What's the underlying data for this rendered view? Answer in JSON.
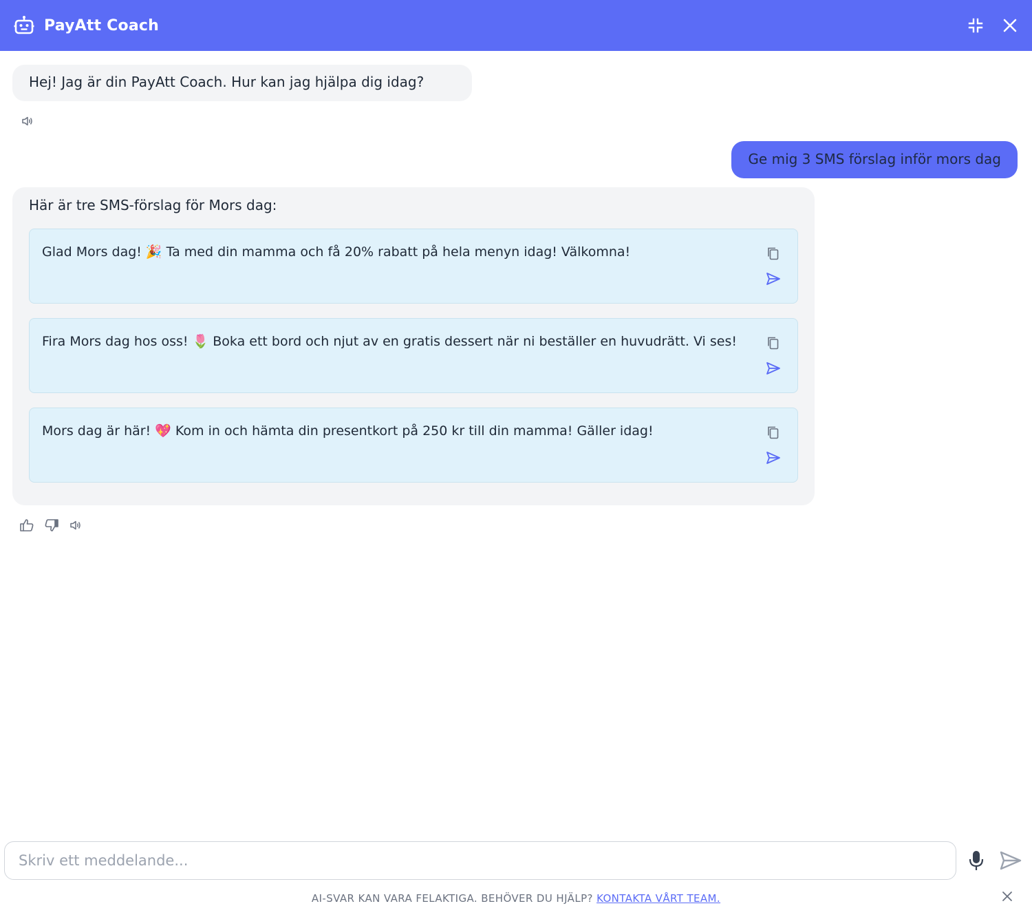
{
  "header": {
    "title": "PayAtt Coach",
    "brand_color": "#5b6cf6",
    "icons": {
      "logo": "robot-icon",
      "minimize": "collapse-icon",
      "close": "close-icon"
    }
  },
  "messages": {
    "greeting": "Hej! Jag är din PayAtt Coach. Hur kan jag hjälpa dig idag?",
    "user_request": "Ge mig 3 SMS förslag inför mors dag",
    "answer_intro": "Här är tre SMS-förslag för Mors dag:",
    "suggestions": [
      {
        "text": "Glad Mors dag! 🎉 Ta med din mamma och få 20% rabatt på hela menyn idag! Välkomna!"
      },
      {
        "text": "Fira Mors dag hos oss! 🌷 Boka ett bord och njut av en gratis dessert när ni beställer en huvudrätt. Vi ses!"
      },
      {
        "text": "Mors dag är här! 💖 Kom in och hämta din presentkort på 250 kr till din mamma! Gäller idag!"
      }
    ]
  },
  "composer": {
    "placeholder": "Skriv ett meddelande...",
    "value": ""
  },
  "footer": {
    "disclaimer": "AI-SVAR KAN VARA FELAKTIGA. BEHÖVER DU HJÄLP?",
    "link_label": "KONTAKTA VÅRT TEAM."
  }
}
